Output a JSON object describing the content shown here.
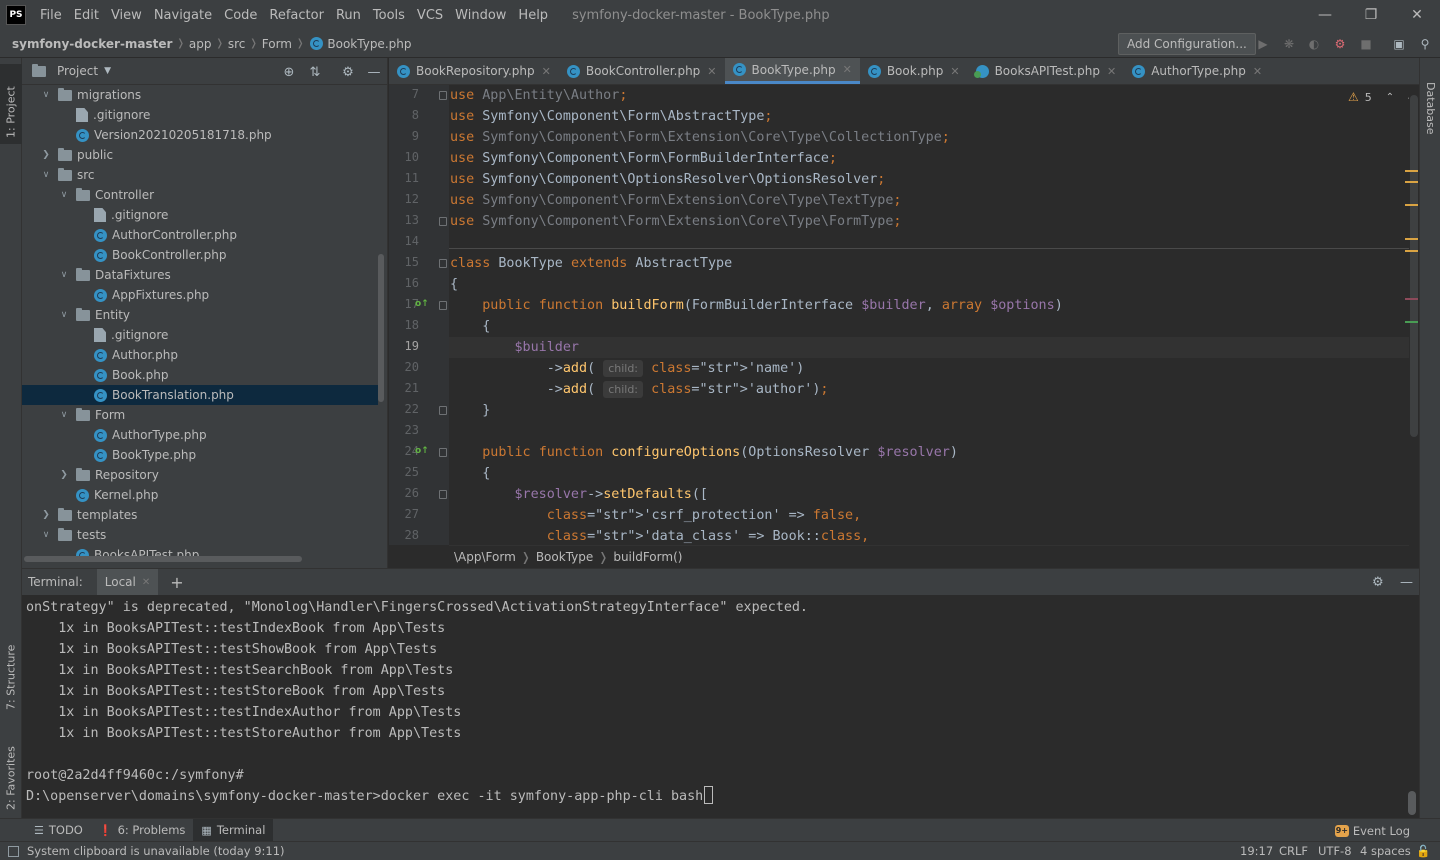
{
  "window": {
    "logo": "PS",
    "title": "symfony-docker-master - BookType.php",
    "menu": [
      "File",
      "Edit",
      "View",
      "Navigate",
      "Code",
      "Refactor",
      "Run",
      "Tools",
      "VCS",
      "Window",
      "Help"
    ]
  },
  "navbar": {
    "crumbs": [
      "symfony-docker-master",
      "app",
      "src",
      "Form",
      "BookType.php"
    ],
    "add_config_label": "Add Configuration..."
  },
  "left_stripe": {
    "project_tab": "1: Project",
    "structure_tab": "7: Structure",
    "favorites_tab": "2: Favorites"
  },
  "right_stripe": {
    "database_tab": "Database"
  },
  "project_panel": {
    "title": "Project",
    "tree": [
      {
        "label": "migrations",
        "type": "folder",
        "open": true
      },
      {
        "label": ".gitignore",
        "type": "git"
      },
      {
        "label": "Version20210205181718.php",
        "type": "php"
      },
      {
        "label": "public",
        "type": "folder",
        "open": false
      },
      {
        "label": "src",
        "type": "folder",
        "open": true
      },
      {
        "label": "Controller",
        "type": "folder",
        "open": true
      },
      {
        "label": ".gitignore",
        "type": "git"
      },
      {
        "label": "AuthorController.php",
        "type": "php"
      },
      {
        "label": "BookController.php",
        "type": "php"
      },
      {
        "label": "DataFixtures",
        "type": "folder",
        "open": true
      },
      {
        "label": "AppFixtures.php",
        "type": "php"
      },
      {
        "label": "Entity",
        "type": "folder",
        "open": true
      },
      {
        "label": ".gitignore",
        "type": "git"
      },
      {
        "label": "Author.php",
        "type": "php"
      },
      {
        "label": "Book.php",
        "type": "php"
      },
      {
        "label": "BookTranslation.php",
        "type": "php",
        "selected": true
      },
      {
        "label": "Form",
        "type": "folder",
        "open": true
      },
      {
        "label": "AuthorType.php",
        "type": "php"
      },
      {
        "label": "BookType.php",
        "type": "php"
      },
      {
        "label": "Repository",
        "type": "folder",
        "open": false
      },
      {
        "label": "Kernel.php",
        "type": "php"
      },
      {
        "label": "templates",
        "type": "folder",
        "open": false
      },
      {
        "label": "tests",
        "type": "folder",
        "open": true
      },
      {
        "label": "BooksAPITest.php",
        "type": "php"
      }
    ]
  },
  "editor": {
    "tabs": [
      {
        "label": "BookRepository.php",
        "active": false
      },
      {
        "label": "BookController.php",
        "active": false
      },
      {
        "label": "BookType.php",
        "active": true
      },
      {
        "label": "Book.php",
        "active": false
      },
      {
        "label": "BooksAPITest.php",
        "active": false,
        "test": true
      },
      {
        "label": "AuthorType.php",
        "active": false
      }
    ],
    "warning_count": "5",
    "current_line": 19,
    "lines": [
      {
        "n": "7",
        "text": "use App\\Entity\\Author;"
      },
      {
        "n": "8",
        "text": "use Symfony\\Component\\Form\\AbstractType;"
      },
      {
        "n": "9",
        "text": "use Symfony\\Component\\Form\\Extension\\Core\\Type\\CollectionType;"
      },
      {
        "n": "10",
        "text": "use Symfony\\Component\\Form\\FormBuilderInterface;"
      },
      {
        "n": "11",
        "text": "use Symfony\\Component\\OptionsResolver\\OptionsResolver;"
      },
      {
        "n": "12",
        "text": "use Symfony\\Component\\Form\\Extension\\Core\\Type\\TextType;"
      },
      {
        "n": "13",
        "text": "use Symfony\\Component\\Form\\Extension\\Core\\Type\\FormType;"
      },
      {
        "n": "14",
        "text": ""
      },
      {
        "n": "15",
        "text": "class BookType extends AbstractType"
      },
      {
        "n": "16",
        "text": "{"
      },
      {
        "n": "17",
        "text": "    public function buildForm(FormBuilderInterface $builder, array $options)"
      },
      {
        "n": "18",
        "text": "    {"
      },
      {
        "n": "19",
        "text": "        $builder"
      },
      {
        "n": "20",
        "text": "            ->add( child: 'name')"
      },
      {
        "n": "21",
        "text": "            ->add( child: 'author');"
      },
      {
        "n": "22",
        "text": "    }"
      },
      {
        "n": "23",
        "text": ""
      },
      {
        "n": "24",
        "text": "    public function configureOptions(OptionsResolver $resolver)"
      },
      {
        "n": "25",
        "text": "    {"
      },
      {
        "n": "26",
        "text": "        $resolver->setDefaults(["
      },
      {
        "n": "27",
        "text": "            'csrf_protection' => false,"
      },
      {
        "n": "28",
        "text": "            'data_class' => Book::class,"
      }
    ],
    "breadcrumb": [
      "\\App\\Form",
      "BookType",
      "buildForm()"
    ]
  },
  "terminal": {
    "label": "Terminal:",
    "tab_label": "Local",
    "lines": [
      "onStrategy\" is deprecated, \"Monolog\\Handler\\FingersCrossed\\ActivationStrategyInterface\" expected.",
      "    1x in BooksAPITest::testIndexBook from App\\Tests",
      "    1x in BooksAPITest::testShowBook from App\\Tests",
      "    1x in BooksAPITest::testSearchBook from App\\Tests",
      "    1x in BooksAPITest::testStoreBook from App\\Tests",
      "    1x in BooksAPITest::testIndexAuthor from App\\Tests",
      "    1x in BooksAPITest::testStoreAuthor from App\\Tests",
      "",
      "root@2a2d4ff9460c:/symfony#",
      "D:\\openserver\\domains\\symfony-docker-master>docker exec -it symfony-app-php-cli bash"
    ]
  },
  "bottom_tools": {
    "todo": "TODO",
    "problems": "6: Problems",
    "terminal": "Terminal",
    "event_log": "Event Log"
  },
  "status": {
    "message": "System clipboard is unavailable (today 9:11)",
    "position": "19:17",
    "line_sep": "CRLF",
    "encoding": "UTF-8",
    "indent": "4 spaces"
  },
  "colors": {
    "accent": "#4a88c7",
    "keyword": "#cc7832",
    "function": "#ffc66d",
    "variable": "#9876aa",
    "string": "#6a8759",
    "warning": "#e4a34b"
  }
}
